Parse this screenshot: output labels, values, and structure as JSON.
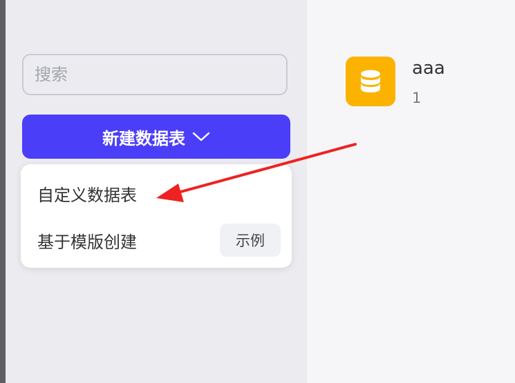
{
  "search": {
    "placeholder": "搜索"
  },
  "new_table_button": {
    "label": "新建数据表",
    "icon": "chevron-down-icon",
    "color": "#4b3ef8"
  },
  "dropdown": {
    "items": [
      {
        "label": "自定义数据表"
      },
      {
        "label": "基于模版创建",
        "badge": "示例"
      }
    ]
  },
  "table_card": {
    "icon": "database-icon",
    "icon_bg": "#fbb200",
    "name": "aaa",
    "count": "1"
  },
  "annotation": {
    "type": "red-arrow",
    "color": "#ee2222",
    "points_to": "自定义数据表"
  }
}
